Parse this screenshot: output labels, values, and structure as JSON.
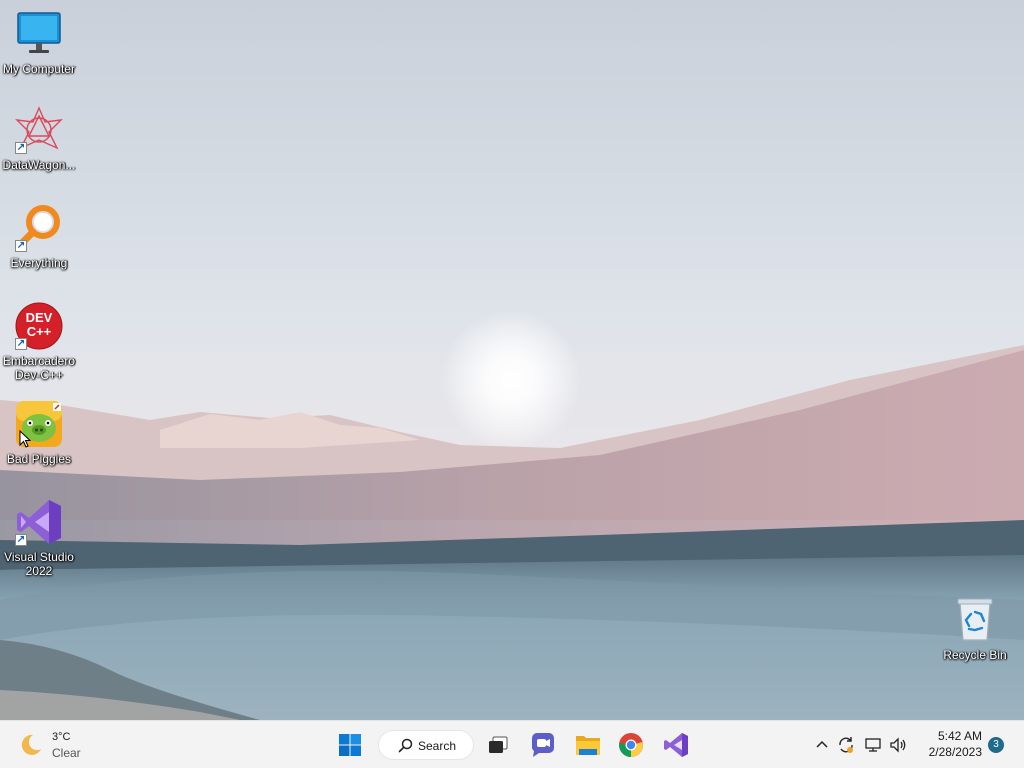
{
  "desktop": {
    "icons": [
      {
        "label": "My Computer",
        "icon": "monitor-icon"
      },
      {
        "label": "DataWagon...",
        "icon": "datawagon-icon"
      },
      {
        "label": "Everything",
        "icon": "everything-search-icon"
      },
      {
        "label": "Embarcadero Dev-C++",
        "icon": "devcpp-icon",
        "badge_text": "DEV C++"
      },
      {
        "label": "Bad Piggies",
        "icon": "bad-piggies-icon"
      },
      {
        "label": "Visual Studio 2022",
        "icon": "visual-studio-icon"
      }
    ],
    "recycle_bin": {
      "label": "Recycle Bin",
      "icon": "recycle-bin-icon"
    }
  },
  "taskbar": {
    "weather": {
      "temperature": "3°C",
      "condition": "Clear",
      "icon": "moon-icon"
    },
    "search_label": "Search",
    "pinned": [
      "windows-start-icon",
      "task-view-icon",
      "chat-icon",
      "file-explorer-icon",
      "chrome-icon",
      "visual-studio-icon"
    ],
    "tray": [
      "chevron-up-icon",
      "sync-icon",
      "network-icon",
      "volume-icon"
    ],
    "clock": {
      "time": "5:42 AM",
      "date": "2/28/2023"
    },
    "notifications_count": "3"
  },
  "colors": {
    "taskbar_bg": "#f3f3f3",
    "accent": "#0067c0",
    "sky_top": "#c9d2dc",
    "water": "#8aa6b6"
  }
}
